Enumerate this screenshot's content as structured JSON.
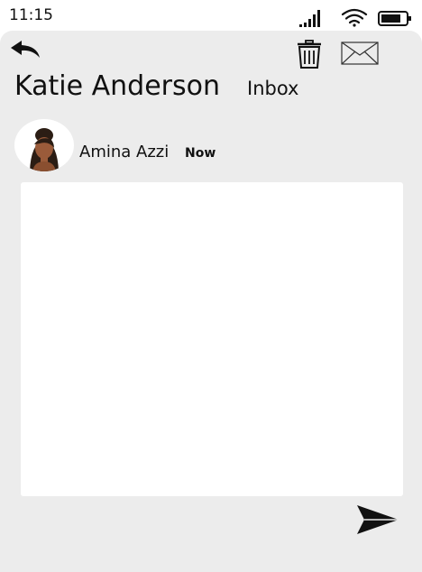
{
  "status_bar": {
    "time": "11:15",
    "icons": [
      "signal-icon",
      "wifi-icon",
      "battery-icon"
    ]
  },
  "toolbar": {
    "back_icon": "reply-arrow-icon",
    "trash_icon": "trash-icon",
    "mail_icon": "envelope-icon"
  },
  "header": {
    "contact_name": "Katie Anderson",
    "folder": "Inbox"
  },
  "message": {
    "sender": "Amina Azzi",
    "time": "Now",
    "body": ""
  },
  "actions": {
    "send_icon": "send-icon"
  }
}
